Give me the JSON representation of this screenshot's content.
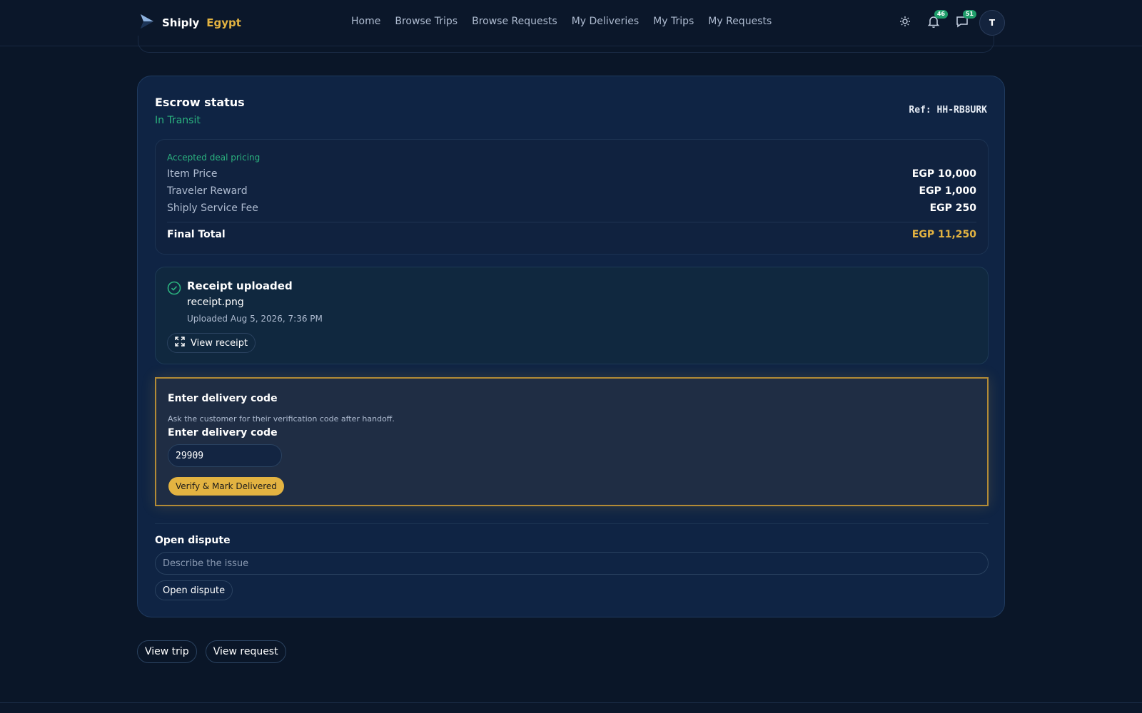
{
  "brand": {
    "name": "Shiply",
    "region": "Egypt"
  },
  "nav": [
    {
      "label": "Home"
    },
    {
      "label": "Browse Trips"
    },
    {
      "label": "Browse Requests"
    },
    {
      "label": "My Deliveries"
    },
    {
      "label": "My Trips"
    },
    {
      "label": "My Requests"
    }
  ],
  "header": {
    "notifications_count": "46",
    "messages_count": "51",
    "avatar_initial": "T"
  },
  "escrow": {
    "title": "Escrow status",
    "status": "In Transit",
    "ref": "Ref: HH-RB8URK",
    "pricing": {
      "label": "Accepted deal pricing",
      "rows": [
        {
          "label": "Item Price",
          "value": "EGP 10,000"
        },
        {
          "label": "Traveler Reward",
          "value": "EGP 1,000"
        },
        {
          "label": "Shiply Service Fee",
          "value": "EGP 250"
        }
      ],
      "total_label": "Final Total",
      "total_value": "EGP 11,250"
    },
    "receipt": {
      "title": "Receipt uploaded",
      "file": "receipt.png",
      "uploaded": "Uploaded Aug 5, 2026, 7:36 PM",
      "view_label": "View receipt"
    },
    "delivery_code": {
      "title": "Enter delivery code",
      "help": "Ask the customer for their verification code after handoff.",
      "input_label": "Enter delivery code",
      "input_value": "29909",
      "verify_label": "Verify & Mark Delivered"
    },
    "dispute": {
      "title": "Open dispute",
      "placeholder": "Describe the issue",
      "button_label": "Open dispute"
    }
  },
  "footer": {
    "view_trip": "View trip",
    "view_request": "View request"
  },
  "colors": {
    "accent": "#e3b341",
    "success": "#2bb37f",
    "background": "#0a1628",
    "card": "#0f2444"
  }
}
